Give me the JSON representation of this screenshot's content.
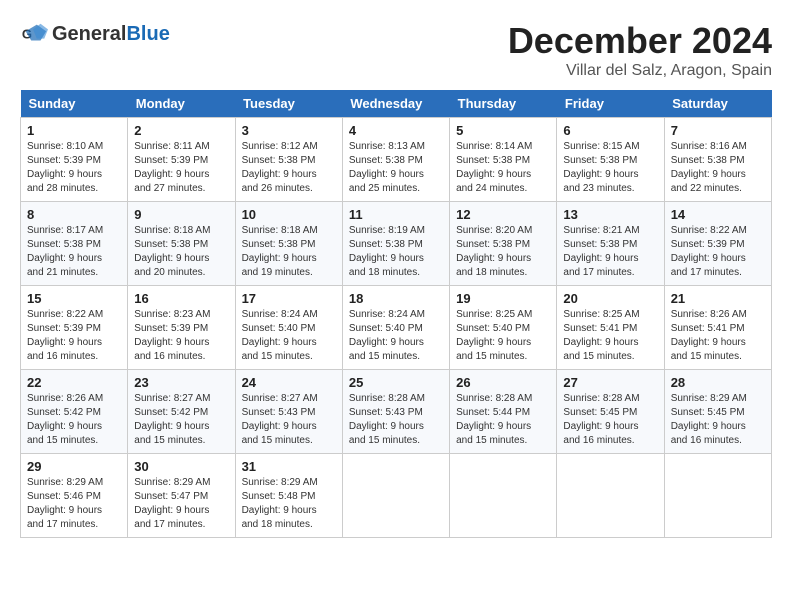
{
  "logo": {
    "text_general": "General",
    "text_blue": "Blue"
  },
  "title": {
    "month": "December 2024",
    "location": "Villar del Salz, Aragon, Spain"
  },
  "weekdays": [
    "Sunday",
    "Monday",
    "Tuesday",
    "Wednesday",
    "Thursday",
    "Friday",
    "Saturday"
  ],
  "days": [
    {
      "date": "1",
      "sunrise": "8:10 AM",
      "sunset": "5:39 PM",
      "daylight": "9 hours and 28 minutes."
    },
    {
      "date": "2",
      "sunrise": "8:11 AM",
      "sunset": "5:39 PM",
      "daylight": "9 hours and 27 minutes."
    },
    {
      "date": "3",
      "sunrise": "8:12 AM",
      "sunset": "5:38 PM",
      "daylight": "9 hours and 26 minutes."
    },
    {
      "date": "4",
      "sunrise": "8:13 AM",
      "sunset": "5:38 PM",
      "daylight": "9 hours and 25 minutes."
    },
    {
      "date": "5",
      "sunrise": "8:14 AM",
      "sunset": "5:38 PM",
      "daylight": "9 hours and 24 minutes."
    },
    {
      "date": "6",
      "sunrise": "8:15 AM",
      "sunset": "5:38 PM",
      "daylight": "9 hours and 23 minutes."
    },
    {
      "date": "7",
      "sunrise": "8:16 AM",
      "sunset": "5:38 PM",
      "daylight": "9 hours and 22 minutes."
    },
    {
      "date": "8",
      "sunrise": "8:17 AM",
      "sunset": "5:38 PM",
      "daylight": "9 hours and 21 minutes."
    },
    {
      "date": "9",
      "sunrise": "8:18 AM",
      "sunset": "5:38 PM",
      "daylight": "9 hours and 20 minutes."
    },
    {
      "date": "10",
      "sunrise": "8:18 AM",
      "sunset": "5:38 PM",
      "daylight": "9 hours and 19 minutes."
    },
    {
      "date": "11",
      "sunrise": "8:19 AM",
      "sunset": "5:38 PM",
      "daylight": "9 hours and 18 minutes."
    },
    {
      "date": "12",
      "sunrise": "8:20 AM",
      "sunset": "5:38 PM",
      "daylight": "9 hours and 18 minutes."
    },
    {
      "date": "13",
      "sunrise": "8:21 AM",
      "sunset": "5:38 PM",
      "daylight": "9 hours and 17 minutes."
    },
    {
      "date": "14",
      "sunrise": "8:22 AM",
      "sunset": "5:39 PM",
      "daylight": "9 hours and 17 minutes."
    },
    {
      "date": "15",
      "sunrise": "8:22 AM",
      "sunset": "5:39 PM",
      "daylight": "9 hours and 16 minutes."
    },
    {
      "date": "16",
      "sunrise": "8:23 AM",
      "sunset": "5:39 PM",
      "daylight": "9 hours and 16 minutes."
    },
    {
      "date": "17",
      "sunrise": "8:24 AM",
      "sunset": "5:40 PM",
      "daylight": "9 hours and 15 minutes."
    },
    {
      "date": "18",
      "sunrise": "8:24 AM",
      "sunset": "5:40 PM",
      "daylight": "9 hours and 15 minutes."
    },
    {
      "date": "19",
      "sunrise": "8:25 AM",
      "sunset": "5:40 PM",
      "daylight": "9 hours and 15 minutes."
    },
    {
      "date": "20",
      "sunrise": "8:25 AM",
      "sunset": "5:41 PM",
      "daylight": "9 hours and 15 minutes."
    },
    {
      "date": "21",
      "sunrise": "8:26 AM",
      "sunset": "5:41 PM",
      "daylight": "9 hours and 15 minutes."
    },
    {
      "date": "22",
      "sunrise": "8:26 AM",
      "sunset": "5:42 PM",
      "daylight": "9 hours and 15 minutes."
    },
    {
      "date": "23",
      "sunrise": "8:27 AM",
      "sunset": "5:42 PM",
      "daylight": "9 hours and 15 minutes."
    },
    {
      "date": "24",
      "sunrise": "8:27 AM",
      "sunset": "5:43 PM",
      "daylight": "9 hours and 15 minutes."
    },
    {
      "date": "25",
      "sunrise": "8:28 AM",
      "sunset": "5:43 PM",
      "daylight": "9 hours and 15 minutes."
    },
    {
      "date": "26",
      "sunrise": "8:28 AM",
      "sunset": "5:44 PM",
      "daylight": "9 hours and 15 minutes."
    },
    {
      "date": "27",
      "sunrise": "8:28 AM",
      "sunset": "5:45 PM",
      "daylight": "9 hours and 16 minutes."
    },
    {
      "date": "28",
      "sunrise": "8:29 AM",
      "sunset": "5:45 PM",
      "daylight": "9 hours and 16 minutes."
    },
    {
      "date": "29",
      "sunrise": "8:29 AM",
      "sunset": "5:46 PM",
      "daylight": "9 hours and 17 minutes."
    },
    {
      "date": "30",
      "sunrise": "8:29 AM",
      "sunset": "5:47 PM",
      "daylight": "9 hours and 17 minutes."
    },
    {
      "date": "31",
      "sunrise": "8:29 AM",
      "sunset": "5:48 PM",
      "daylight": "9 hours and 18 minutes."
    }
  ],
  "labels": {
    "sunrise": "Sunrise:",
    "sunset": "Sunset:",
    "daylight": "Daylight:"
  }
}
